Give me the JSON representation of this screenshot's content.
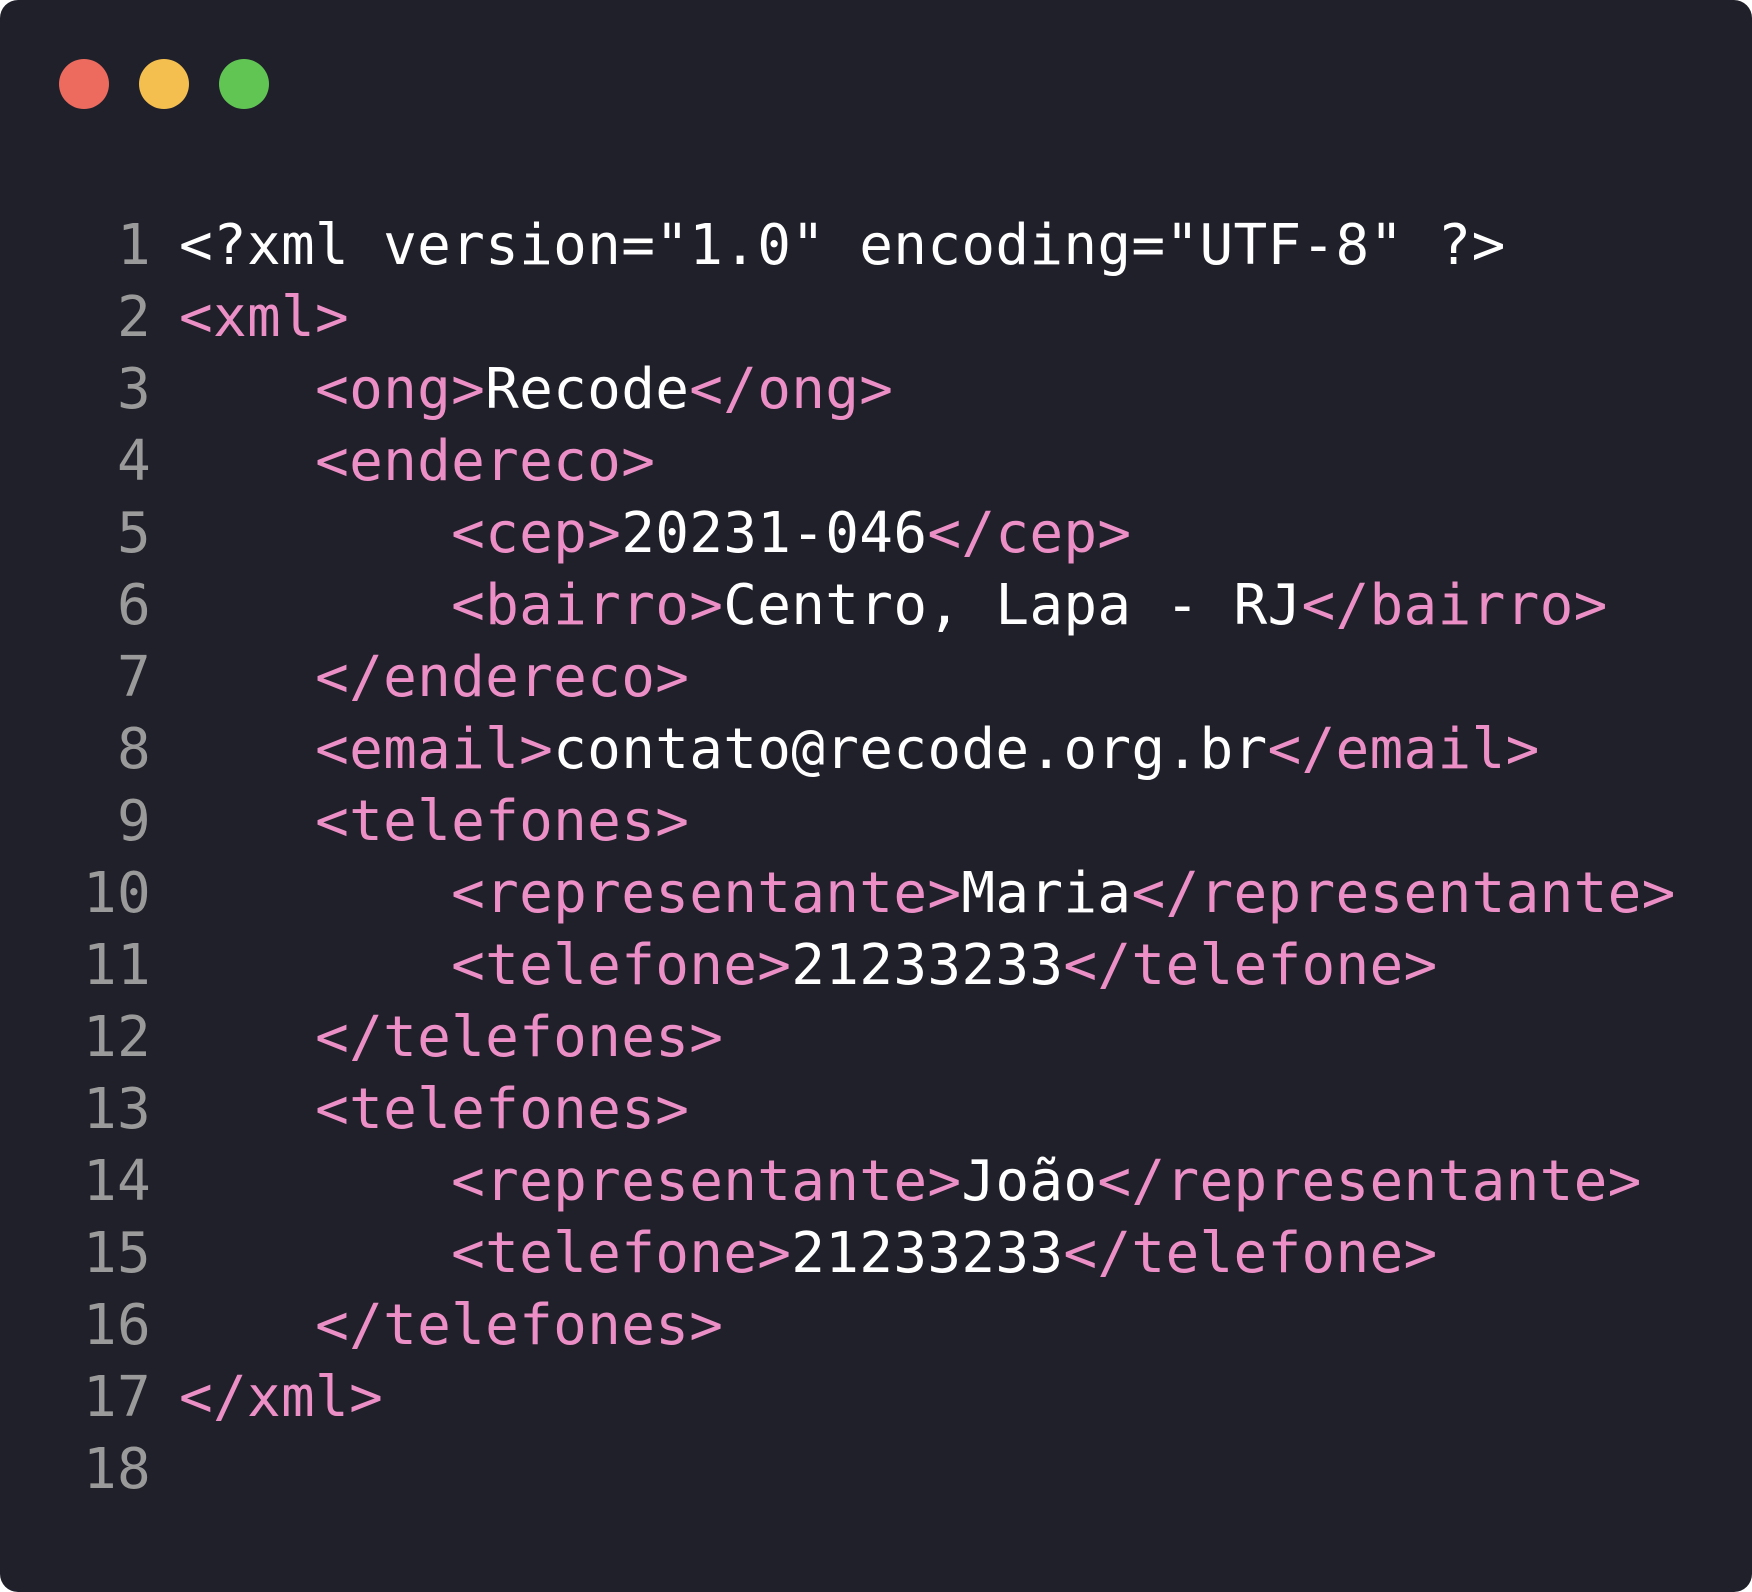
{
  "window": {
    "buttons": {
      "close_color": "#ec6b5e",
      "minimize_color": "#f4bf4f",
      "maximize_color": "#61c554"
    }
  },
  "colors": {
    "background": "#20202a",
    "tag": "#ec8fc6",
    "text": "#ffffff",
    "line_number": "#9a9a9a"
  },
  "code": {
    "lines": [
      {
        "number": "1",
        "indent": "",
        "segments": [
          {
            "text": "<?xml version=\"1.0\" encoding=\"UTF-8\" ?>",
            "kind": "txt"
          }
        ]
      },
      {
        "number": "2",
        "indent": "",
        "segments": [
          {
            "text": "<xml>",
            "kind": "tag"
          }
        ]
      },
      {
        "number": "3",
        "indent": "    ",
        "segments": [
          {
            "text": "<ong>",
            "kind": "tag"
          },
          {
            "text": "Recode",
            "kind": "txt"
          },
          {
            "text": "</ong>",
            "kind": "tag"
          }
        ]
      },
      {
        "number": "4",
        "indent": "    ",
        "segments": [
          {
            "text": "<endereco>",
            "kind": "tag"
          }
        ]
      },
      {
        "number": "5",
        "indent": "        ",
        "segments": [
          {
            "text": "<cep>",
            "kind": "tag"
          },
          {
            "text": "20231-046",
            "kind": "txt"
          },
          {
            "text": "</cep>",
            "kind": "tag"
          }
        ]
      },
      {
        "number": "6",
        "indent": "        ",
        "segments": [
          {
            "text": "<bairro>",
            "kind": "tag"
          },
          {
            "text": "Centro, Lapa - RJ",
            "kind": "txt"
          },
          {
            "text": "</bairro>",
            "kind": "tag"
          }
        ]
      },
      {
        "number": "7",
        "indent": "    ",
        "segments": [
          {
            "text": "</endereco>",
            "kind": "tag"
          }
        ]
      },
      {
        "number": "8",
        "indent": "    ",
        "segments": [
          {
            "text": "<email>",
            "kind": "tag"
          },
          {
            "text": "contato@recode.org.br",
            "kind": "txt"
          },
          {
            "text": "</email>",
            "kind": "tag"
          }
        ]
      },
      {
        "number": "9",
        "indent": "    ",
        "segments": [
          {
            "text": "<telefones>",
            "kind": "tag"
          }
        ]
      },
      {
        "number": "10",
        "indent": "        ",
        "segments": [
          {
            "text": "<representante>",
            "kind": "tag"
          },
          {
            "text": "Maria",
            "kind": "txt"
          },
          {
            "text": "</representante>",
            "kind": "tag"
          }
        ]
      },
      {
        "number": "11",
        "indent": "        ",
        "segments": [
          {
            "text": "<telefone>",
            "kind": "tag"
          },
          {
            "text": "21233233",
            "kind": "txt"
          },
          {
            "text": "</telefone>",
            "kind": "tag"
          }
        ]
      },
      {
        "number": "12",
        "indent": "    ",
        "segments": [
          {
            "text": "</telefones>",
            "kind": "tag"
          }
        ]
      },
      {
        "number": "13",
        "indent": "    ",
        "segments": [
          {
            "text": "<telefones>",
            "kind": "tag"
          }
        ]
      },
      {
        "number": "14",
        "indent": "        ",
        "segments": [
          {
            "text": "<representante>",
            "kind": "tag"
          },
          {
            "text": "João",
            "kind": "txt"
          },
          {
            "text": "</representante>",
            "kind": "tag"
          }
        ]
      },
      {
        "number": "15",
        "indent": "        ",
        "segments": [
          {
            "text": "<telefone>",
            "kind": "tag"
          },
          {
            "text": "21233233",
            "kind": "txt"
          },
          {
            "text": "</telefone>",
            "kind": "tag"
          }
        ]
      },
      {
        "number": "16",
        "indent": "    ",
        "segments": [
          {
            "text": "</telefones>",
            "kind": "tag"
          }
        ]
      },
      {
        "number": "17",
        "indent": "",
        "segments": [
          {
            "text": "</xml>",
            "kind": "tag"
          }
        ]
      },
      {
        "number": "18",
        "indent": "",
        "segments": []
      }
    ]
  }
}
